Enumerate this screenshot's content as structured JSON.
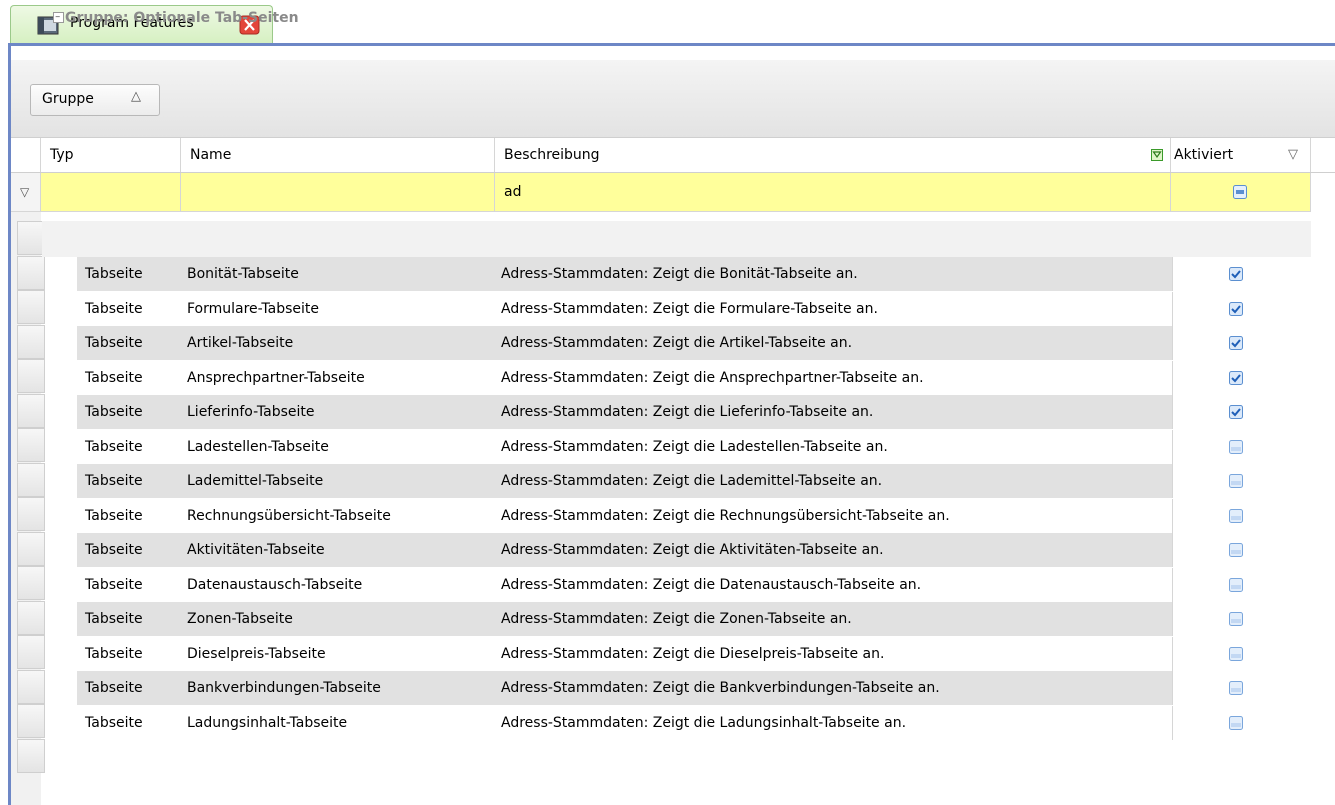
{
  "tab": {
    "title": "Program Features"
  },
  "grouping": {
    "label": "Gruppe",
    "sort_glyph": "△"
  },
  "columns": {
    "typ": "Typ",
    "name": "Name",
    "beschreibung": "Beschreibung",
    "aktiviert": "Aktiviert",
    "filter_glyph": "▽"
  },
  "filter": {
    "indicator_glyph": "▽",
    "beschreibung_value": "ad"
  },
  "group": {
    "label": "Gruppe: Optionale Tab-Seiten"
  },
  "rows": [
    {
      "typ": "Tabseite",
      "name": "Bonität-Tabseite",
      "beschreibung": "Adress-Stammdaten: Zeigt die Bonität-Tabseite an.",
      "aktiviert": true
    },
    {
      "typ": "Tabseite",
      "name": "Formulare-Tabseite",
      "beschreibung": "Adress-Stammdaten: Zeigt die Formulare-Tabseite an.",
      "aktiviert": true
    },
    {
      "typ": "Tabseite",
      "name": "Artikel-Tabseite",
      "beschreibung": "Adress-Stammdaten: Zeigt die Artikel-Tabseite an.",
      "aktiviert": true
    },
    {
      "typ": "Tabseite",
      "name": "Ansprechpartner-Tabseite",
      "beschreibung": "Adress-Stammdaten: Zeigt die Ansprechpartner-Tabseite an.",
      "aktiviert": true
    },
    {
      "typ": "Tabseite",
      "name": "Lieferinfo-Tabseite",
      "beschreibung": "Adress-Stammdaten: Zeigt die Lieferinfo-Tabseite an.",
      "aktiviert": true
    },
    {
      "typ": "Tabseite",
      "name": "Ladestellen-Tabseite",
      "beschreibung": "Adress-Stammdaten: Zeigt die Ladestellen-Tabseite an.",
      "aktiviert": false
    },
    {
      "typ": "Tabseite",
      "name": "Lademittel-Tabseite",
      "beschreibung": "Adress-Stammdaten: Zeigt die Lademittel-Tabseite an.",
      "aktiviert": false
    },
    {
      "typ": "Tabseite",
      "name": "Rechnungsübersicht-Tabseite",
      "beschreibung": "Adress-Stammdaten: Zeigt die Rechnungsübersicht-Tabseite an.",
      "aktiviert": false
    },
    {
      "typ": "Tabseite",
      "name": "Aktivitäten-Tabseite",
      "beschreibung": "Adress-Stammdaten: Zeigt die Aktivitäten-Tabseite an.",
      "aktiviert": false
    },
    {
      "typ": "Tabseite",
      "name": "Datenaustausch-Tabseite",
      "beschreibung": "Adress-Stammdaten: Zeigt die Datenaustausch-Tabseite an.",
      "aktiviert": false
    },
    {
      "typ": "Tabseite",
      "name": "Zonen-Tabseite",
      "beschreibung": "Adress-Stammdaten: Zeigt die Zonen-Tabseite an.",
      "aktiviert": false
    },
    {
      "typ": "Tabseite",
      "name": "Dieselpreis-Tabseite",
      "beschreibung": "Adress-Stammdaten: Zeigt die Dieselpreis-Tabseite an.",
      "aktiviert": false
    },
    {
      "typ": "Tabseite",
      "name": "Bankverbindungen-Tabseite",
      "beschreibung": "Adress-Stammdaten: Zeigt die Bankverbindungen-Tabseite an.",
      "aktiviert": false
    },
    {
      "typ": "Tabseite",
      "name": "Ladungsinhalt-Tabseite",
      "beschreibung": "Adress-Stammdaten: Zeigt die Ladungsinhalt-Tabseite an.",
      "aktiviert": false
    }
  ],
  "colors": {
    "filter_row": "#ffff9b",
    "accent_border": "#6d87c6",
    "checkbox": "#3b7fd0"
  }
}
